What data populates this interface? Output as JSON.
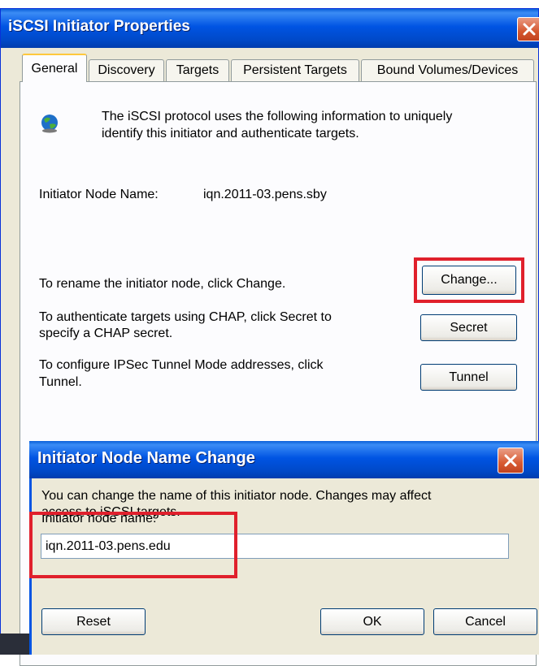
{
  "window": {
    "title": "iSCSI Initiator Properties"
  },
  "tabs": [
    {
      "label": "General",
      "active": true
    },
    {
      "label": "Discovery"
    },
    {
      "label": "Targets"
    },
    {
      "label": "Persistent Targets"
    },
    {
      "label": "Bound Volumes/Devices"
    }
  ],
  "general": {
    "intro_line1": "The iSCSI protocol uses the following information to uniquely",
    "intro_line2": "identify this initiator and authenticate targets.",
    "node_name_label": "Initiator Node Name:",
    "node_name_value": "iqn.2011-03.pens.sby",
    "rename_text": "To rename the initiator node, click Change.",
    "change_button": "Change...",
    "chap_line1": "To authenticate targets using CHAP, click Secret to",
    "chap_line2": "specify a CHAP secret.",
    "secret_button": "Secret",
    "ipsec_line1": "To configure IPSec Tunnel Mode addresses, click",
    "ipsec_line2": "Tunnel.",
    "tunnel_button": "Tunnel"
  },
  "dialog": {
    "title": "Initiator Node Name Change",
    "message_line1": "You can change the name of this initiator node.  Changes may affect",
    "message_line2": "access to iSCSI targets.",
    "field_label": "Initiator node name:",
    "field_value": "iqn.2011-03.pens.edu",
    "reset_button": "Reset",
    "ok_button": "OK",
    "cancel_button": "Cancel"
  },
  "colors": {
    "titlebar": "#0054e3",
    "window_bg": "#ece9d8",
    "highlight": "#e0202c"
  }
}
